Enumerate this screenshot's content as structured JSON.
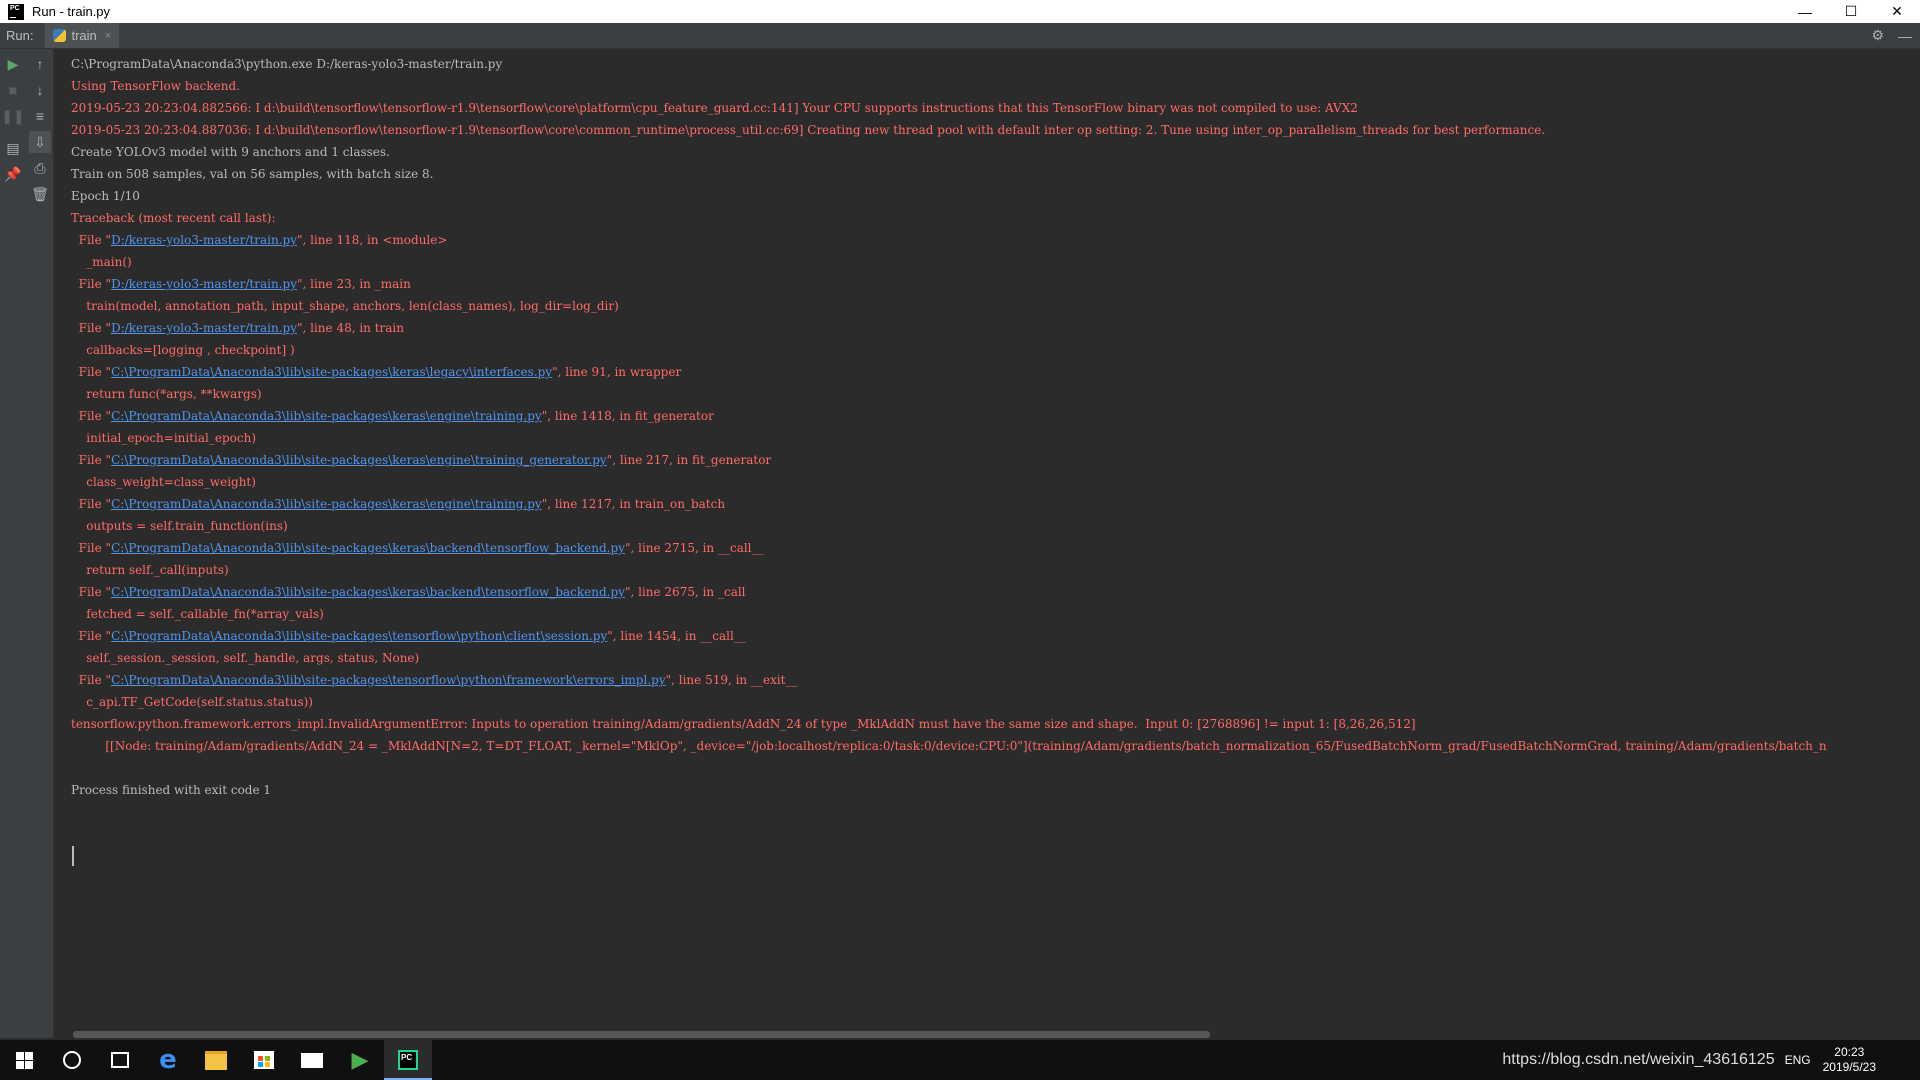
{
  "window": {
    "title": "Run - train.py",
    "app_icon_text": "PC",
    "controls": {
      "minimize": "—",
      "maximize": "☐",
      "close": "✕"
    }
  },
  "run_panel": {
    "label": "Run:",
    "tab_label": "train",
    "tab_close": "×"
  },
  "console": {
    "lines": [
      {
        "type": "out",
        "text": "C:\\ProgramData\\Anaconda3\\python.exe D:/keras-yolo3-master/train.py"
      },
      {
        "type": "err",
        "text": "Using TensorFlow backend."
      },
      {
        "type": "err",
        "text": "2019-05-23 20:23:04.882566: I d:\\build\\tensorflow\\tensorflow-r1.9\\tensorflow\\core\\platform\\cpu_feature_guard.cc:141] Your CPU supports instructions that this TensorFlow binary was not compiled to use: AVX2"
      },
      {
        "type": "err",
        "text": "2019-05-23 20:23:04.887036: I d:\\build\\tensorflow\\tensorflow-r1.9\\tensorflow\\core\\common_runtime\\process_util.cc:69] Creating new thread pool with default inter op setting: 2. Tune using inter_op_parallelism_threads for best performance."
      },
      {
        "type": "out",
        "text": "Create YOLOv3 model with 9 anchors and 1 classes."
      },
      {
        "type": "out",
        "text": "Train on 508 samples, val on 56 samples, with batch size 8."
      },
      {
        "type": "out",
        "text": "Epoch 1/10"
      },
      {
        "type": "err",
        "text": "Traceback (most recent call last):"
      },
      {
        "type": "err",
        "pre": "  File \"",
        "link": "D:/keras-yolo3-master/train.py",
        "post": "\", line 118, in <module>"
      },
      {
        "type": "err",
        "text": "    _main()"
      },
      {
        "type": "err",
        "pre": "  File \"",
        "link": "D:/keras-yolo3-master/train.py",
        "post": "\", line 23, in _main"
      },
      {
        "type": "err",
        "text": "    train(model, annotation_path, input_shape, anchors, len(class_names), log_dir=log_dir)"
      },
      {
        "type": "err",
        "pre": "  File \"",
        "link": "D:/keras-yolo3-master/train.py",
        "post": "\", line 48, in train"
      },
      {
        "type": "err",
        "text": "    callbacks=[logging , checkpoint] )"
      },
      {
        "type": "err",
        "pre": "  File \"",
        "link": "C:\\ProgramData\\Anaconda3\\lib\\site-packages\\keras\\legacy\\interfaces.py",
        "post": "\", line 91, in wrapper"
      },
      {
        "type": "err",
        "text": "    return func(*args, **kwargs)"
      },
      {
        "type": "err",
        "pre": "  File \"",
        "link": "C:\\ProgramData\\Anaconda3\\lib\\site-packages\\keras\\engine\\training.py",
        "post": "\", line 1418, in fit_generator"
      },
      {
        "type": "err",
        "text": "    initial_epoch=initial_epoch)"
      },
      {
        "type": "err",
        "pre": "  File \"",
        "link": "C:\\ProgramData\\Anaconda3\\lib\\site-packages\\keras\\engine\\training_generator.py",
        "post": "\", line 217, in fit_generator"
      },
      {
        "type": "err",
        "text": "    class_weight=class_weight)"
      },
      {
        "type": "err",
        "pre": "  File \"",
        "link": "C:\\ProgramData\\Anaconda3\\lib\\site-packages\\keras\\engine\\training.py",
        "post": "\", line 1217, in train_on_batch"
      },
      {
        "type": "err",
        "text": "    outputs = self.train_function(ins)"
      },
      {
        "type": "err",
        "pre": "  File \"",
        "link": "C:\\ProgramData\\Anaconda3\\lib\\site-packages\\keras\\backend\\tensorflow_backend.py",
        "post": "\", line 2715, in __call__"
      },
      {
        "type": "err",
        "text": "    return self._call(inputs)"
      },
      {
        "type": "err",
        "pre": "  File \"",
        "link": "C:\\ProgramData\\Anaconda3\\lib\\site-packages\\keras\\backend\\tensorflow_backend.py",
        "post": "\", line 2675, in _call"
      },
      {
        "type": "err",
        "text": "    fetched = self._callable_fn(*array_vals)"
      },
      {
        "type": "err",
        "pre": "  File \"",
        "link": "C:\\ProgramData\\Anaconda3\\lib\\site-packages\\tensorflow\\python\\client\\session.py",
        "post": "\", line 1454, in __call__"
      },
      {
        "type": "err",
        "text": "    self._session._session, self._handle, args, status, None)"
      },
      {
        "type": "err",
        "pre": "  File \"",
        "link": "C:\\ProgramData\\Anaconda3\\lib\\site-packages\\tensorflow\\python\\framework\\errors_impl.py",
        "post": "\", line 519, in __exit__"
      },
      {
        "type": "err",
        "text": "    c_api.TF_GetCode(self.status.status))"
      },
      {
        "type": "err",
        "text": "tensorflow.python.framework.errors_impl.InvalidArgumentError: Inputs to operation training/Adam/gradients/AddN_24 of type _MklAddN must have the same size and shape.  Input 0: [2768896] != input 1: [8,26,26,512]"
      },
      {
        "type": "err",
        "text": "\t [[Node: training/Adam/gradients/AddN_24 = _MklAddN[N=2, T=DT_FLOAT, _kernel=\"MklOp\", _device=\"/job:localhost/replica:0/task:0/device:CPU:0\"](training/Adam/gradients/batch_normalization_65/FusedBatchNorm_grad/FusedBatchNormGrad, training/Adam/gradients/batch_n"
      },
      {
        "type": "out",
        "text": ""
      },
      {
        "type": "out",
        "text": "Process finished with exit code 1"
      }
    ]
  },
  "taskbar": {
    "watermark": "https://blog.csdn.net/weixin_43616125",
    "lang": "ENG",
    "time": "20:23",
    "date": "2019/5/23"
  }
}
